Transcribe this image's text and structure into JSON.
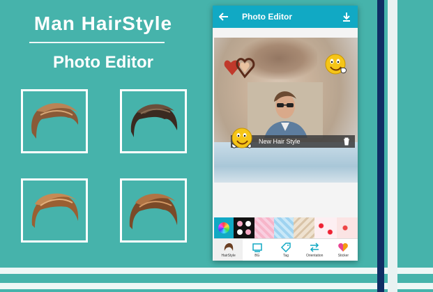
{
  "promo": {
    "title": "Man HairStyle",
    "subtitle": "Photo Editor"
  },
  "hair_samples": [
    {
      "icon": "hairstyle-sample-1-icon"
    },
    {
      "icon": "hairstyle-sample-2-icon"
    },
    {
      "icon": "hairstyle-sample-3-icon"
    },
    {
      "icon": "hairstyle-sample-4-icon"
    }
  ],
  "app": {
    "header": {
      "title": "Photo Editor",
      "back_icon": "back-arrow-icon",
      "download_icon": "download-icon",
      "color": "#11a9c4"
    },
    "canvas": {
      "caption": "New Hair Style"
    },
    "toolbar": {
      "items": [
        {
          "label": "HairStyle",
          "icon": "hairstyle-icon"
        },
        {
          "label": "BG",
          "icon": "background-icon"
        },
        {
          "label": "Tag",
          "icon": "tag-icon"
        },
        {
          "label": "Orientation",
          "icon": "orientation-icon"
        },
        {
          "label": "Sticker",
          "icon": "sticker-icon"
        }
      ]
    }
  },
  "colors": {
    "background": "#46b3ab",
    "accent_bar": "#0f2d64"
  }
}
